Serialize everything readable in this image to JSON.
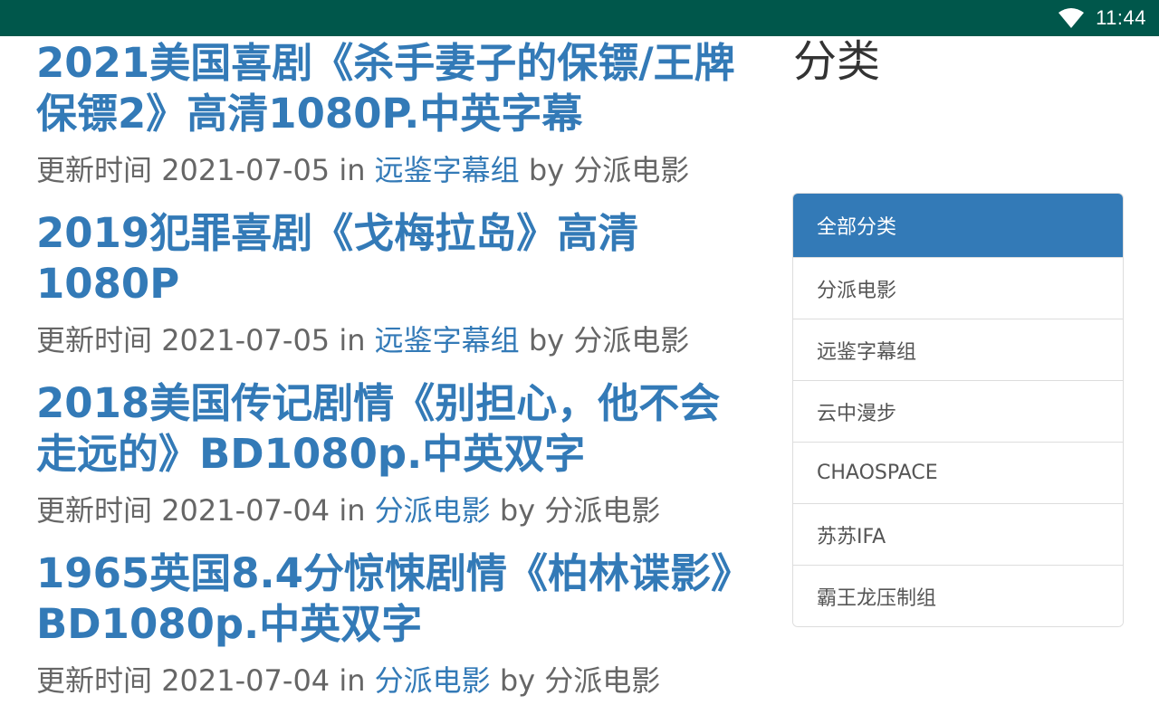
{
  "status_bar": {
    "time": "11:44",
    "wifi_icon": "wifi-icon",
    "background_color": "#00574b"
  },
  "posts": [
    {
      "title": "2021美国喜剧《杀手妻子的保镖/王牌保镖2》高清1080P.中英字幕",
      "date_label": "更新时间",
      "date": "2021-07-05",
      "in_word": "in",
      "category": "远鉴字幕组",
      "by_word": "by",
      "author": "分派电影"
    },
    {
      "title": "2019犯罪喜剧《戈梅拉岛》高清1080P",
      "date_label": "更新时间",
      "date": "2021-07-05",
      "in_word": "in",
      "category": "远鉴字幕组",
      "by_word": "by",
      "author": "分派电影"
    },
    {
      "title": "2018美国传记剧情《别担心，他不会走远的》BD1080p.中英双字",
      "date_label": "更新时间",
      "date": "2021-07-04",
      "in_word": "in",
      "category": "分派电影",
      "by_word": "by",
      "author": "分派电影"
    },
    {
      "title": "1965英国8.4分惊悚剧情《柏林谍影》BD1080p.中英双字",
      "date_label": "更新时间",
      "date": "2021-07-04",
      "in_word": "in",
      "category": "分派电影",
      "by_word": "by",
      "author": "分派电影"
    }
  ],
  "sidebar": {
    "heading": "分类",
    "categories": [
      {
        "label": "全部分类",
        "active": true
      },
      {
        "label": "分派电影",
        "active": false
      },
      {
        "label": "远鉴字幕组",
        "active": false
      },
      {
        "label": "云中漫步",
        "active": false
      },
      {
        "label": "CHAOSPACE",
        "active": false
      },
      {
        "label": "苏苏IFA",
        "active": false
      },
      {
        "label": "霸王龙压制组",
        "active": false
      }
    ]
  },
  "colors": {
    "link": "#337ab7",
    "meta_text": "#666666",
    "active_bg": "#337ab7"
  }
}
